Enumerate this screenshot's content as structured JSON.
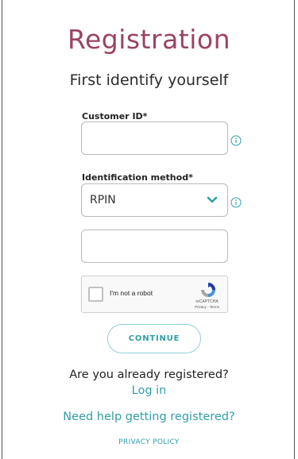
{
  "page": {
    "title": "Registration",
    "subtitle": "First identify yourself"
  },
  "form": {
    "customer_id": {
      "label": "Customer ID*",
      "value": "",
      "placeholder": ""
    },
    "identification_method": {
      "label": "Identification method*",
      "selected": "RPIN"
    },
    "method_value": {
      "value": "",
      "placeholder": ""
    },
    "captcha": {
      "label": "I'm not a robot",
      "brand": "reCAPTCHA",
      "links": "Privacy - Terms"
    },
    "continue_label": "CONTINUE"
  },
  "footer": {
    "already_registered": "Are you already registered?",
    "login_link": "Log in",
    "help_link": "Need help getting registered?",
    "privacy_link": "PRIVACY POLICY"
  },
  "colors": {
    "title": "#9b4266",
    "accent": "#2f9fa6"
  },
  "icons": {
    "info": "info-circle-icon",
    "chevron": "chevron-down-icon",
    "recaptcha": "recaptcha-logo-icon"
  }
}
